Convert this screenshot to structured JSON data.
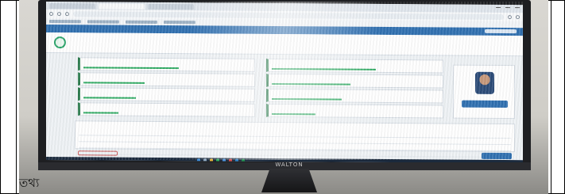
{
  "caption": "তথ্য",
  "monitor": {
    "brand": "WALTON"
  },
  "app": {
    "title": "",
    "subtitle": "",
    "accent_color": "#2f6fb0",
    "success_color": "#2eaa62"
  },
  "cards": [
    {
      "label": "",
      "value": "",
      "progress": 0.55
    },
    {
      "label": "",
      "value": "",
      "progress": 0.6
    },
    {
      "label": "",
      "value": "",
      "progress": 0.35
    },
    {
      "label": "",
      "value": "",
      "progress": 0.45
    },
    {
      "label": "",
      "value": "",
      "progress": 0.3
    },
    {
      "label": "",
      "value": "",
      "progress": 0.4
    },
    {
      "label": "",
      "value": "",
      "progress": 0.2
    },
    {
      "label": "",
      "value": "",
      "progress": 0.25
    }
  ],
  "profile": {
    "button_label": ""
  },
  "table": {
    "title": "",
    "headers": [
      "",
      "",
      "",
      ""
    ],
    "rows": [
      [
        "",
        "",
        "",
        ""
      ],
      [
        "",
        "",
        "",
        ""
      ],
      [
        "",
        "",
        "",
        ""
      ]
    ]
  },
  "footer": {
    "notice": "",
    "submit_label": ""
  },
  "taskbar": {
    "clock": ""
  }
}
